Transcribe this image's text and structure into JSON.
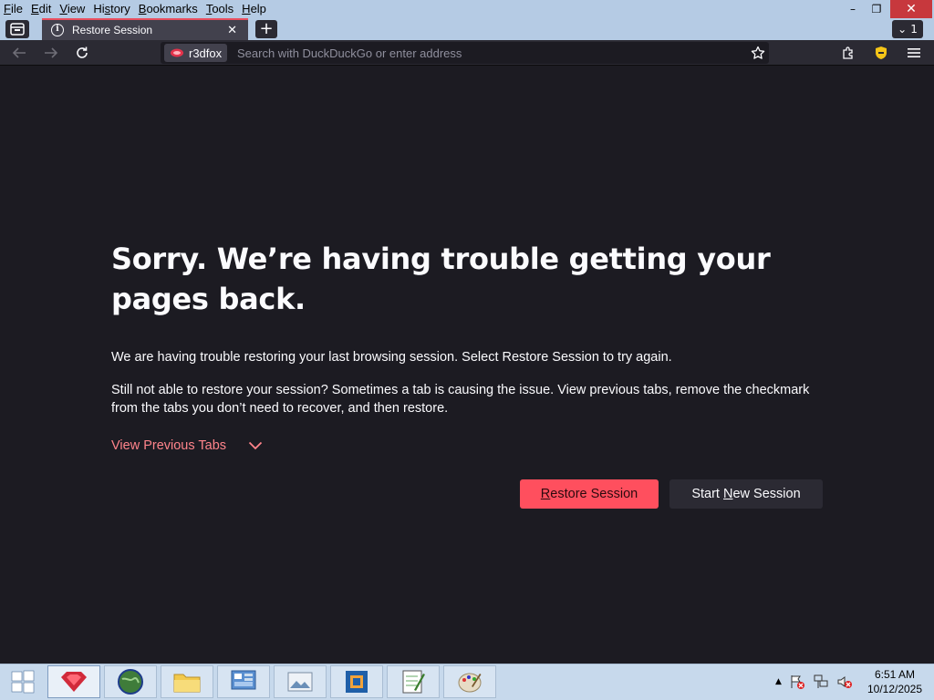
{
  "menu": {
    "items": [
      {
        "label": "File",
        "key": "F",
        "rest": "ile"
      },
      {
        "label": "Edit",
        "key": "E",
        "rest": "dit"
      },
      {
        "label": "View",
        "key": "V",
        "rest": "iew"
      },
      {
        "label": "History",
        "pre": "Hi",
        "key": "s",
        "rest": "tory"
      },
      {
        "label": "Bookmarks",
        "key": "B",
        "rest": "ookmarks"
      },
      {
        "label": "Tools",
        "key": "T",
        "rest": "ools"
      },
      {
        "label": "Help",
        "key": "H",
        "rest": "elp"
      }
    ]
  },
  "window": {
    "minimize": "–",
    "restore": "❐",
    "close": "✕"
  },
  "tabs": {
    "active_title": "Restore Session",
    "list_count": "1"
  },
  "navbar": {
    "identity_label": "r3dfox",
    "url_placeholder": "Search with DuckDuckGo or enter address"
  },
  "page": {
    "heading": "Sorry. We’re having trouble getting your pages back.",
    "paragraph1": "We are having trouble restoring your last browsing session. Select Restore Session to try again.",
    "paragraph2": "Still not able to restore your session? Sometimes a tab is causing the issue. View previous tabs, remove the checkmark from the tabs you don’t need to recover, and then restore.",
    "view_previous": "View Previous Tabs",
    "restore_button": {
      "key": "R",
      "rest": "estore Session"
    },
    "new_button": {
      "pre": "Start ",
      "key": "N",
      "rest": "ew Session"
    }
  },
  "taskbar": {
    "clock_time": "6:51 AM",
    "clock_date": "10/12/2025"
  },
  "colors": {
    "accent_tab": "#e94f5f",
    "primary_button": "#ff4f5e",
    "link": "#ff848b",
    "content_bg": "#1c1b22"
  }
}
